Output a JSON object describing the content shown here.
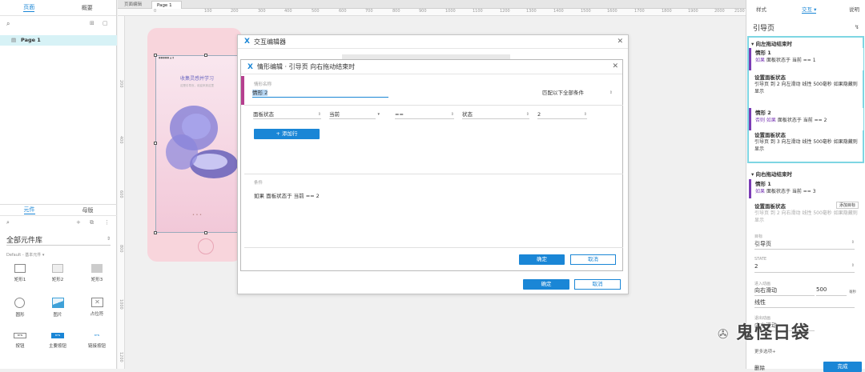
{
  "left_panel": {
    "tabs": [
      "页面",
      "概要"
    ],
    "page_item": "Page 1",
    "lib_tabs": [
      "元件",
      "母版"
    ],
    "library": "全部元件库",
    "filter": "Default - 基本元件 ▾",
    "components": [
      "矩形1",
      "矩形2",
      "矩形3",
      "圆形",
      "图片",
      "占位符",
      "按钮",
      "主要按钮",
      "链接按钮"
    ]
  },
  "canvas": {
    "tabs": [
      "页面编辑",
      "Page 1"
    ],
    "ruler_marks": [
      "0",
      "100",
      "200",
      "300",
      "400",
      "500",
      "600",
      "700",
      "800",
      "900",
      "1000",
      "1100",
      "1200",
      "1300",
      "1400",
      "1500",
      "1600",
      "1700",
      "1800",
      "1900",
      "2000",
      "2100"
    ],
    "ruler_v_marks": [
      "100",
      "200",
      "300",
      "400",
      "500",
      "600",
      "700",
      "800",
      "900",
      "1000",
      "1100",
      "1200"
    ],
    "phone_title": "收集灵感并学习",
    "phone_subtitle": "这是引导页，欢迎来到这里"
  },
  "outer_dialog": {
    "title": "交互编辑器",
    "ok": "确定",
    "cancel": "取消"
  },
  "inner_dialog": {
    "title": "情形编辑 · 引导页 向右拖动结束时",
    "case_name_label": "情形名称",
    "case_name": "情形 2",
    "match": "匹配以下全部条件",
    "condition": {
      "type": "面板状态",
      "target": "当前",
      "op": "==",
      "value_type": "状态",
      "value": "2"
    },
    "add_row": "+ 添加行",
    "summary_label": "条件",
    "summary": "如果 面板状态于 当前 == 2",
    "ok": "确定",
    "cancel": "取消"
  },
  "right_panel": {
    "tabs": [
      "样式",
      "交互 ▾",
      "说明"
    ],
    "title": "引导页",
    "section1": "▾ 向左拖动结束时",
    "case1_title": "情形 1",
    "case1_cond_kw": "如果",
    "case1_cond": "面板状态于 当前 == 1",
    "case1_action_title": "设置面板状态",
    "case1_action": "引导页 到 2 向左滑动 线性 500毫秒 如果隐藏则显示",
    "case2_title": "情形 2",
    "case2_cond_kw": "否则 如果",
    "case2_cond": "面板状态于 当前 == 2",
    "case2_action_title": "设置面板状态",
    "case2_action": "引导页 到 3 向左滑动 线性 500毫秒 如果隐藏则显示",
    "section2": "▾ 向右拖动结束时",
    "case3_title": "情形 1",
    "case3_cond_kw": "如果",
    "case3_cond": "面板状态于 当前 == 3",
    "case3_action_title": "设置面板状态",
    "case3_action_btn": "添加目标",
    "case3_action": "引导页 到 2 向右滑动 线性 500毫秒 如果隐藏则显示",
    "target_label": "目标",
    "target": "引导页",
    "state_label": "STATE",
    "state": "2",
    "anim_in_label": "进入动画",
    "anim_in": "向右滑动",
    "duration": "500",
    "unit": "毫秒",
    "easing": "线性",
    "anim_out_label": "退出动画",
    "anim_out": "向右滑动",
    "more": "更多选项+",
    "delete": "删除",
    "done": "完成"
  },
  "watermark": "鬼怪日袋"
}
